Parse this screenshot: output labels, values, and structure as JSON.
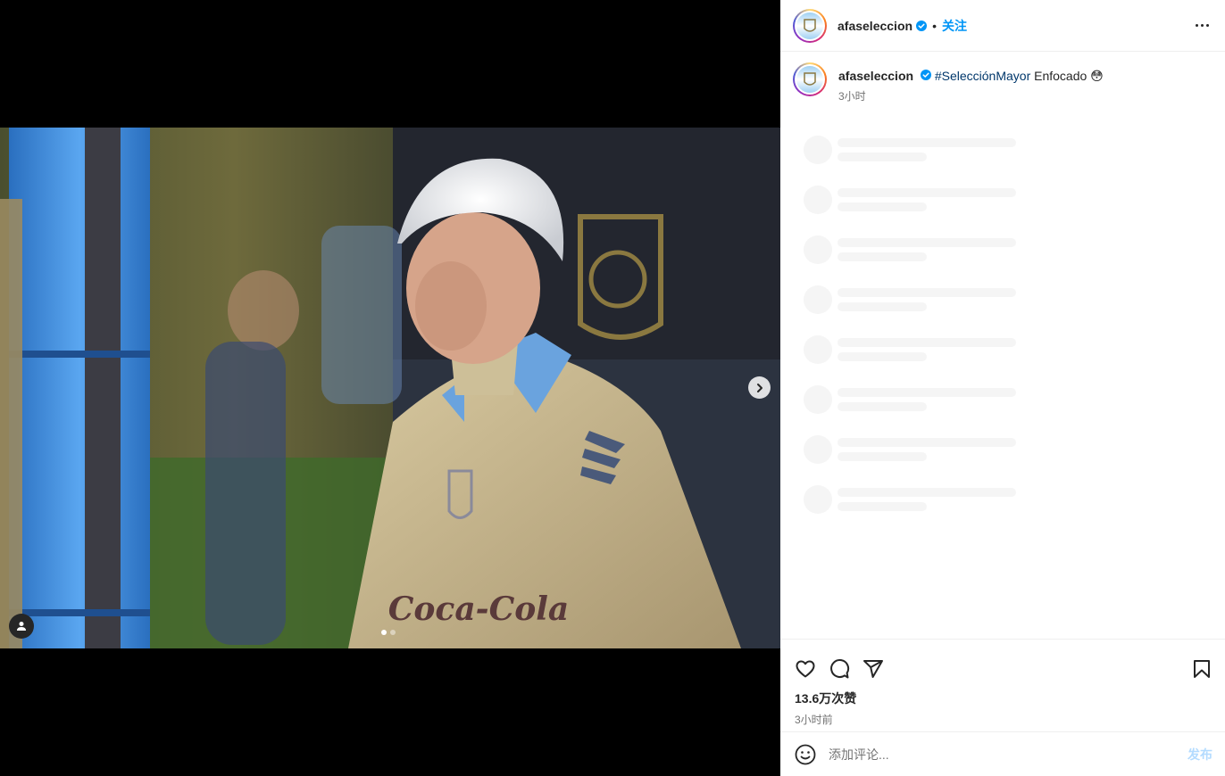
{
  "post": {
    "username": "afaseleccion",
    "separator": "•",
    "follow_label": "关注",
    "caption": {
      "username": "afaseleccion",
      "hashtag": "#SelecciónMayor",
      "text": " Enfocado ",
      "emoji": "😳",
      "time": "3小时"
    },
    "likes": "13.6万次赞",
    "posted_ago": "3小时前",
    "comment_placeholder": "添加评论...",
    "post_label": "发布",
    "photo_print": "Coca-Cola",
    "carousel": {
      "count": 2,
      "active_index": 0
    }
  },
  "colors": {
    "link_blue": "#0095f6",
    "hashtag": "#00376b",
    "post_disabled": "#b3dbff",
    "verified": "#0095f6"
  },
  "icons": [
    "verified-badge-icon",
    "more-options-icon",
    "heart-icon",
    "comment-icon",
    "share-icon",
    "bookmark-icon",
    "emoji-icon",
    "chevron-right-icon",
    "user-tag-icon"
  ]
}
